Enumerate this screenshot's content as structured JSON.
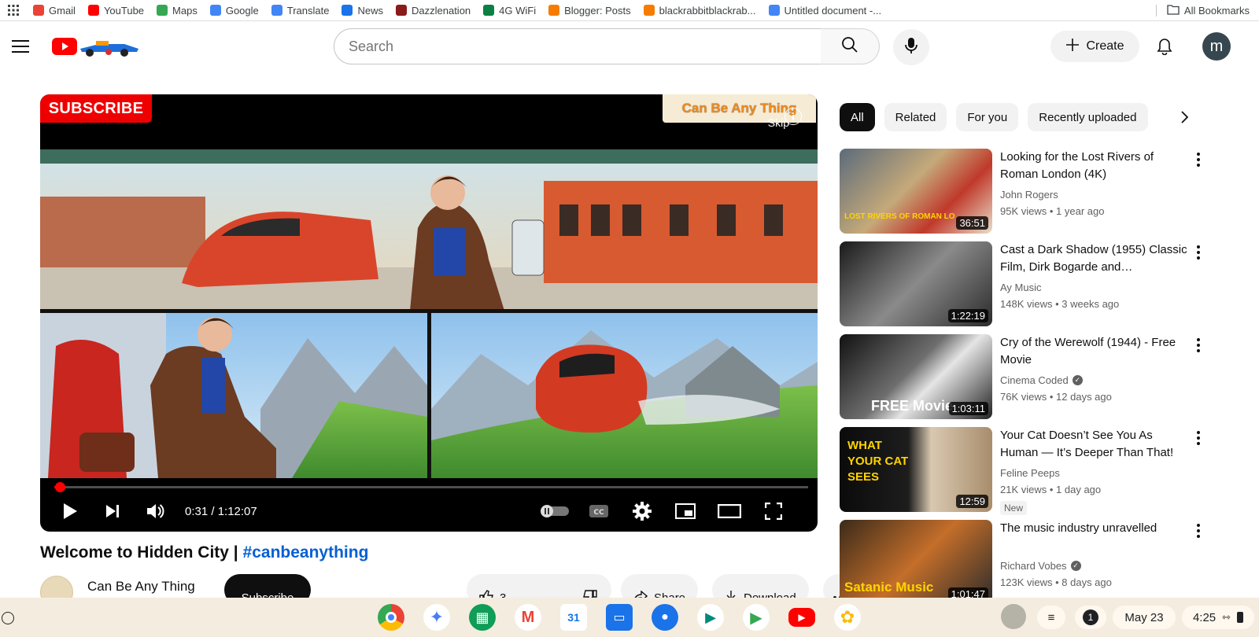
{
  "bookmarks": [
    {
      "label": "Gmail",
      "color": "#ea4335"
    },
    {
      "label": "YouTube",
      "color": "#ff0000"
    },
    {
      "label": "Maps",
      "color": "#34a853"
    },
    {
      "label": "Google",
      "color": "#4285f4"
    },
    {
      "label": "Translate",
      "color": "#4285f4"
    },
    {
      "label": "News",
      "color": "#1a73e8"
    },
    {
      "label": "Dazzlenation",
      "color": "#8b1a1a"
    },
    {
      "label": "4G WiFi",
      "color": "#0b8043"
    },
    {
      "label": "Blogger: Posts",
      "color": "#f57c00"
    },
    {
      "label": "blackrabbitblackrab...",
      "color": "#f57c00"
    },
    {
      "label": "Untitled document -...",
      "color": "#4285f4"
    }
  ],
  "all_bookmarks": "All Bookmarks",
  "search": {
    "placeholder": "Search"
  },
  "header": {
    "create_label": "Create",
    "avatar_letter": "m"
  },
  "player": {
    "subscribe_badge": "SUBSCRIBE",
    "brand_text": "Can Be Any Thing",
    "skip_text": "Skip",
    "time": "0:31 / 1:12:07",
    "progress_fraction": 0.007
  },
  "video": {
    "title": "Welcome to Hidden City | ",
    "hashtag": "#canbeanything",
    "channel": "Can Be Any Thing",
    "subscribe_label": "Subscribe",
    "likes": "3",
    "share_label": "Share",
    "download_label": "Download"
  },
  "chips": [
    "All",
    "Related",
    "For you",
    "Recently uploaded"
  ],
  "recommendations": [
    {
      "title": "Looking for the Lost Rivers of Roman London (4K)",
      "channel": "John Rogers",
      "verified": false,
      "views": "95K views",
      "age": "1 year ago",
      "duration": "36:51",
      "thumb_text": "LOST RIVERS OF ROMAN LO",
      "new": ""
    },
    {
      "title": "Cast a Dark Shadow (1955) Classic Film, Dirk Bogarde and…",
      "channel": "Ay Music",
      "verified": false,
      "views": "148K views",
      "age": "3 weeks ago",
      "duration": "1:22:19",
      "thumb_text": "",
      "new": ""
    },
    {
      "title": "Cry of the Werewolf (1944) - Free Movie",
      "channel": "Cinema Coded",
      "verified": true,
      "views": "76K views",
      "age": "12 days ago",
      "duration": "1:03:11",
      "thumb_text": "FREE Movie",
      "new": ""
    },
    {
      "title": "Your Cat Doesn’t See You As Human — It’s Deeper Than That!",
      "channel": "Feline Peeps",
      "verified": false,
      "views": "21K views",
      "age": "1 day ago",
      "duration": "12:59",
      "thumb_text": "WHAT YOUR CAT SEES",
      "new": "New"
    },
    {
      "title": "The music industry unravelled",
      "channel": "Richard Vobes",
      "verified": true,
      "views": "123K views",
      "age": "8 days ago",
      "duration": "1:01:47",
      "thumb_text": "Satanic Music",
      "new": ""
    }
  ],
  "shelf": {
    "notification_count": "1",
    "date": "May 23",
    "time": "4:25"
  }
}
